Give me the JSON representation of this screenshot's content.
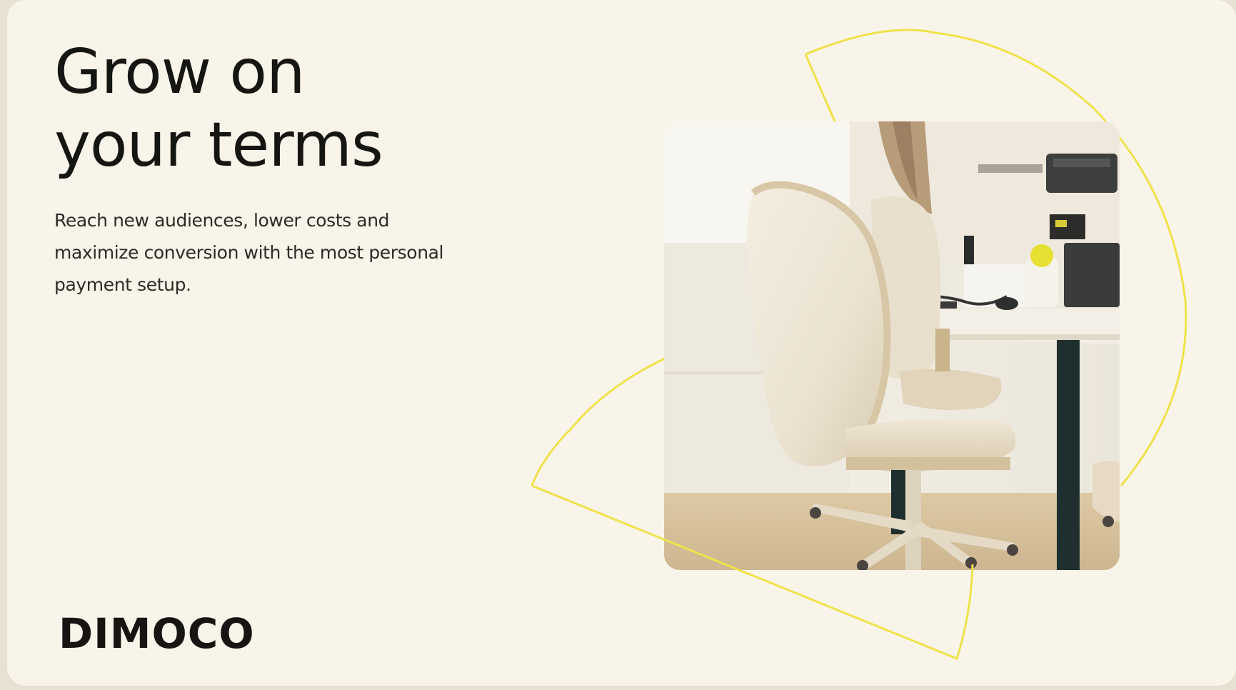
{
  "hero": {
    "headline_line1": "Grow on",
    "headline_line2": "your terms",
    "subcopy": "Reach new audiences, lower costs and maximize conversion with the most personal payment setup."
  },
  "brand": {
    "logo_text": "DIMOCO"
  },
  "colors": {
    "background": "#f9f4ea",
    "text": "#151512",
    "accent_yellow": "#efe24a",
    "desk_leg": "#1f2f2f"
  }
}
